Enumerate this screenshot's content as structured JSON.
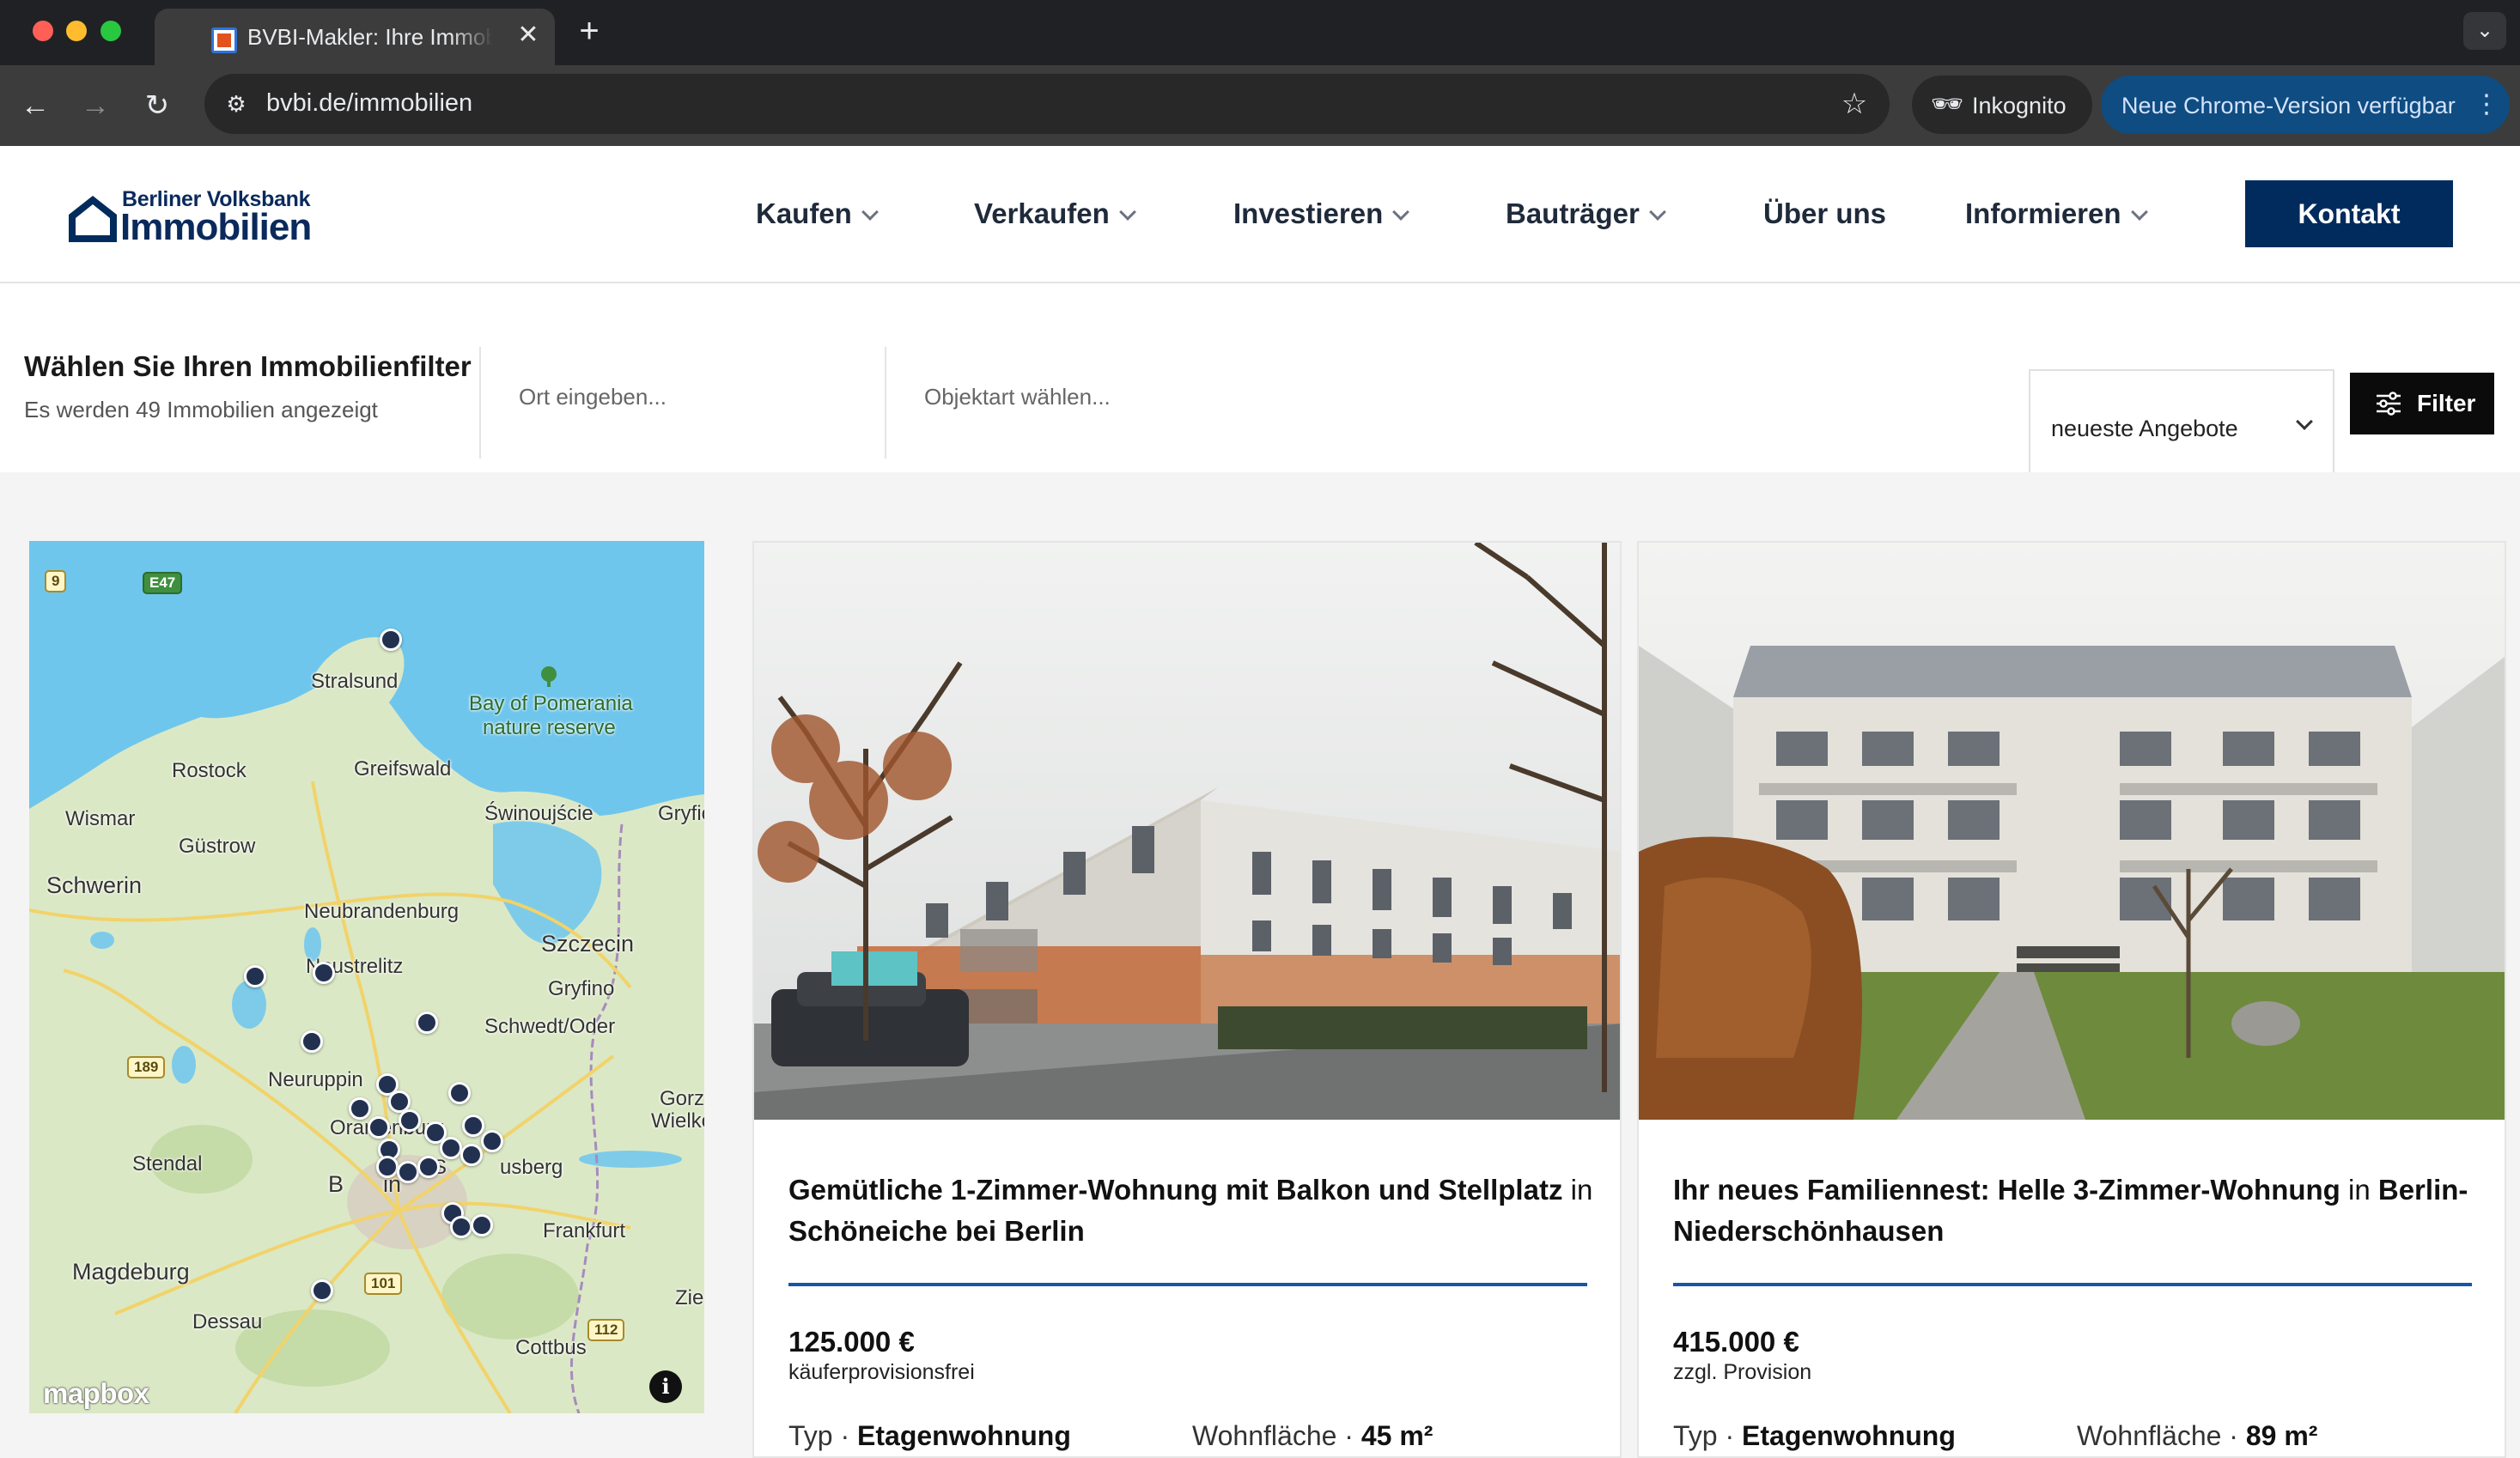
{
  "browser": {
    "tab_title": "BVBI-Makler: Ihre Immobilien",
    "url": "bvbi.de/immobilien",
    "incognito_label": "Inkognito",
    "update_label": "Neue Chrome-Version verfügbar"
  },
  "header": {
    "logo_top": "Berliner Volksbank",
    "logo_bottom": "Immobilien",
    "nav": [
      {
        "label": "Kaufen",
        "dropdown": true
      },
      {
        "label": "Verkaufen",
        "dropdown": true
      },
      {
        "label": "Investieren",
        "dropdown": true
      },
      {
        "label": "Bauträger",
        "dropdown": true
      },
      {
        "label": "Über uns",
        "dropdown": false
      },
      {
        "label": "Informieren",
        "dropdown": true
      }
    ],
    "contact_label": "Kontakt"
  },
  "filter": {
    "title": "Wählen Sie Ihren Immobilienfilter",
    "count_text": "Es werden 49 Immobilien angezeigt",
    "location_placeholder": "Ort eingeben...",
    "type_placeholder": "Objektart wählen...",
    "sort_value": "neueste Angebote",
    "filter_button": "Filter"
  },
  "map": {
    "attribution": "mapbox",
    "info_label": "i",
    "places": [
      "Stralsund",
      "Bay of Pomerania",
      "nature reserve",
      "Rostock",
      "Greifswald",
      "Wismar",
      "Świnoujście",
      "Gryfic",
      "Güstrow",
      "Schwerin",
      "Neubrandenburg",
      "Szczecin",
      "Neustrelitz",
      "Gryfino",
      "Schwedt/Oder",
      "Neuruppin",
      "Gorz",
      "Wielkop",
      "Oranienburg",
      "Stendal",
      "B",
      "in",
      "S",
      "usberg",
      "Frankfurt",
      "Magdeburg",
      "Zie",
      "Dessau",
      "Cottbus"
    ],
    "roads": [
      "9",
      "E47",
      "189",
      "101",
      "112"
    ]
  },
  "listings": [
    {
      "title_bold": "Gemütliche 1-Zimmer-Wohnung mit Balkon und Stellplatz",
      "title_connector": "in",
      "title_location": "Schöneiche bei Berlin",
      "price": "125.000 €",
      "price_note": "käuferprovisionsfrei",
      "type_label": "Typ ·",
      "type_value": "Etagenwohnung",
      "area_label": "Wohnfläche ·",
      "area_value": "45 m²"
    },
    {
      "title_bold": "Ihr neues Familiennest: Helle 3-Zimmer-Wohnung",
      "title_connector": "in",
      "title_location": "Berlin-Niederschönhausen",
      "price": "415.000 €",
      "price_note": "zzgl. Provision",
      "type_label": "Typ ·",
      "type_value": "Etagenwohnung",
      "area_label": "Wohnfläche ·",
      "area_value": "89 m²"
    }
  ],
  "colors": {
    "brand_navy": "#002b5c",
    "accent_blue": "#1557a6",
    "map_marker": "#233150"
  }
}
